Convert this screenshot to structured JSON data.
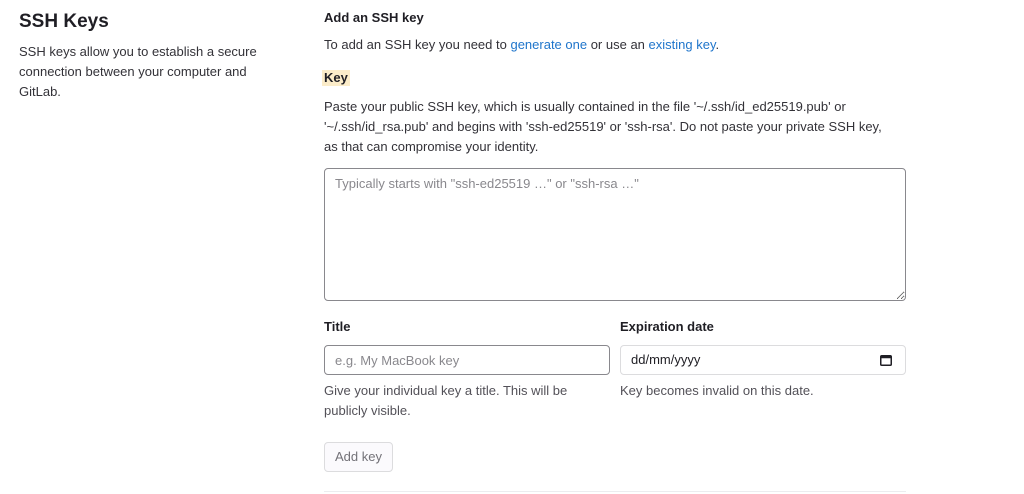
{
  "sidebar": {
    "title": "SSH Keys",
    "description": "SSH keys allow you to establish a secure connection between your computer and GitLab."
  },
  "form": {
    "heading": "Add an SSH key",
    "intro_before": "To add an SSH key you need to ",
    "generate_link": "generate one",
    "intro_middle": " or use an ",
    "existing_link": "existing key",
    "intro_after": ".",
    "key_label": "Key",
    "key_help": "Paste your public SSH key, which is usually contained in the file '~/.ssh/id_ed25519.pub' or '~/.ssh/id_rsa.pub' and begins with 'ssh-ed25519' or 'ssh-rsa'. Do not paste your private SSH key, as that can compromise your identity.",
    "key_placeholder": "Typically starts with \"ssh-ed25519 …\" or \"ssh-rsa …\"",
    "title_label": "Title",
    "title_placeholder": "e.g. My MacBook key",
    "title_help": "Give your individual key a title. This will be publicly visible.",
    "expiration_label": "Expiration date",
    "expiration_value": "dd/mm/yyyy",
    "expiration_help": "Key becomes invalid on this date.",
    "submit_label": "Add key"
  },
  "colors": {
    "link": "#1f75cb",
    "highlight": "#fbecc9",
    "border": "#89888d"
  },
  "icons": [
    "calendar-icon"
  ]
}
